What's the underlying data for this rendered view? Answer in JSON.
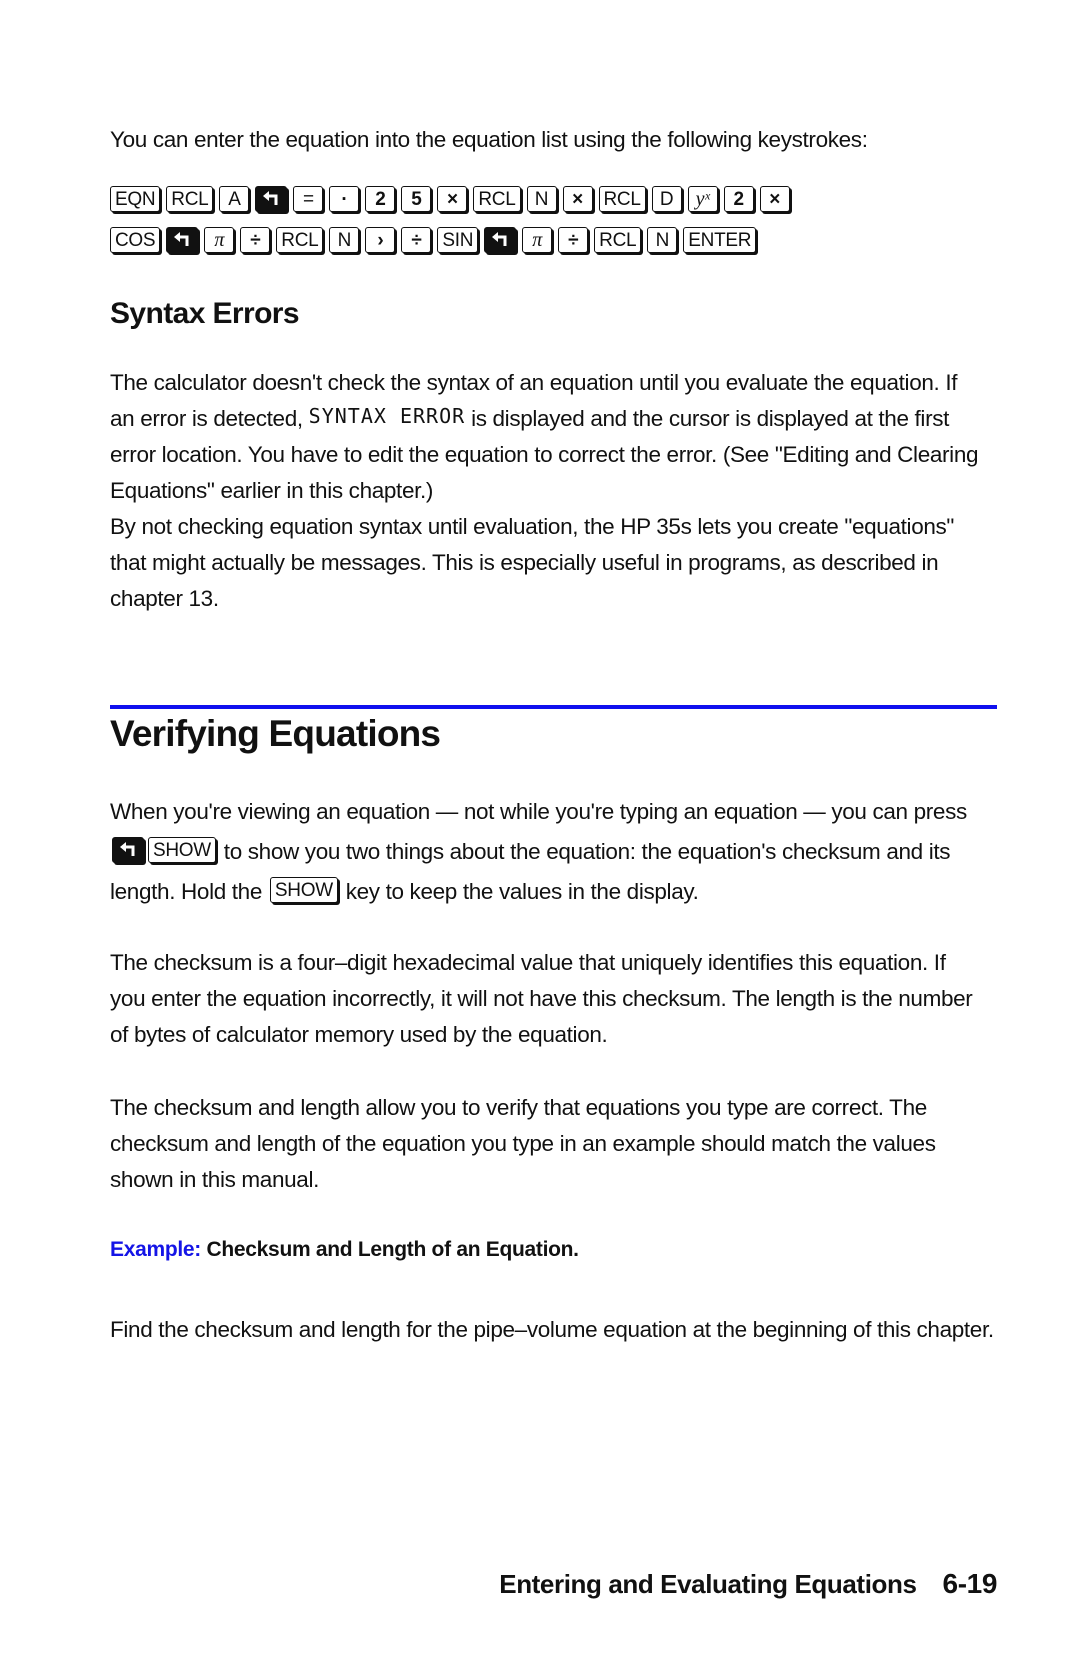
{
  "intro": {
    "text": "You can enter the equation into the equation list using the following keystrokes:"
  },
  "keystrokes": {
    "row1": [
      {
        "label": "EQN",
        "style": "normal",
        "icon": ""
      },
      {
        "label": "RCL",
        "style": "normal",
        "icon": ""
      },
      {
        "label": "A",
        "style": "normal",
        "icon": ""
      },
      {
        "label": "",
        "style": "shift",
        "icon": "left-shift-arrow-icon"
      },
      {
        "label": "=",
        "style": "normal",
        "icon": ""
      },
      {
        "label": "·",
        "style": "bold",
        "icon": ""
      },
      {
        "label": "2",
        "style": "bold",
        "icon": ""
      },
      {
        "label": "5",
        "style": "bold",
        "icon": ""
      },
      {
        "label": "×",
        "style": "bold",
        "icon": ""
      },
      {
        "label": "RCL",
        "style": "normal",
        "icon": ""
      },
      {
        "label": "N",
        "style": "normal",
        "icon": ""
      },
      {
        "label": "×",
        "style": "bold",
        "icon": ""
      },
      {
        "label": "RCL",
        "style": "normal",
        "icon": ""
      },
      {
        "label": "D",
        "style": "normal",
        "icon": ""
      },
      {
        "label": "yˣ",
        "style": "italic",
        "icon": ""
      },
      {
        "label": "2",
        "style": "bold",
        "icon": ""
      },
      {
        "label": "×",
        "style": "bold",
        "icon": ""
      }
    ],
    "row2": [
      {
        "label": "COS",
        "style": "normal",
        "icon": ""
      },
      {
        "label": "",
        "style": "shift",
        "icon": "left-shift-arrow-icon"
      },
      {
        "label": "π",
        "style": "italic",
        "icon": ""
      },
      {
        "label": "÷",
        "style": "bold",
        "icon": ""
      },
      {
        "label": "RCL",
        "style": "normal",
        "icon": ""
      },
      {
        "label": "N",
        "style": "normal",
        "icon": ""
      },
      {
        "label": "›",
        "style": "bold",
        "icon": ""
      },
      {
        "label": "÷",
        "style": "bold",
        "icon": ""
      },
      {
        "label": "SIN",
        "style": "normal",
        "icon": ""
      },
      {
        "label": "",
        "style": "shift",
        "icon": "left-shift-arrow-icon"
      },
      {
        "label": "π",
        "style": "italic",
        "icon": ""
      },
      {
        "label": "÷",
        "style": "bold",
        "icon": ""
      },
      {
        "label": "RCL",
        "style": "normal",
        "icon": ""
      },
      {
        "label": "N",
        "style": "normal",
        "icon": ""
      },
      {
        "label": "ENTER",
        "style": "normal",
        "icon": ""
      }
    ]
  },
  "syntax_errors": {
    "heading": "Syntax Errors",
    "p1_a": "The calculator doesn't check the syntax of an equation until you evaluate the equation. If an error is detected, ",
    "p1_display": "SYNTAX ERROR",
    "p1_b": " is displayed and the cursor is displayed at the first error location. You have to edit the equation to correct the error. (See \"Editing and Clearing Equations\" earlier in this chapter.)",
    "p2": "By not checking equation syntax until evaluation, the HP 35s lets you create \"equations\" that might actually be messages. This is especially useful in programs, as described in chapter 13."
  },
  "verifying": {
    "heading": "Verifying Equations",
    "p1_a": "When you're viewing an equation — not while you're typing an equation — you can press ",
    "p1_key_show": "SHOW",
    "p1_b": " to show you two things about the equation: the equation's checksum and its length. Hold the ",
    "p1_c": " key to keep the values in the display.",
    "p2": "The checksum is a four–digit hexadecimal value that uniquely identifies this equation. If you enter the equation incorrectly, it will not have this checksum. The length is the number of bytes of calculator memory used by the equation.",
    "p3": "The checksum and length allow you to verify that equations you type are correct. The checksum and length of the equation you type in an example should match the values shown in this manual.",
    "example_label": "Example:",
    "example_title": "Checksum and Length of an Equation.",
    "p4": "Find the checksum and length for the pipe–volume equation at the beginning of this chapter."
  },
  "footer": {
    "chapter_title": "Entering and Evaluating Equations",
    "page_number": "6-19"
  },
  "colors": {
    "accent_blue": "#1414e6",
    "rule_blue": "#1010ee",
    "text": "#111111"
  }
}
